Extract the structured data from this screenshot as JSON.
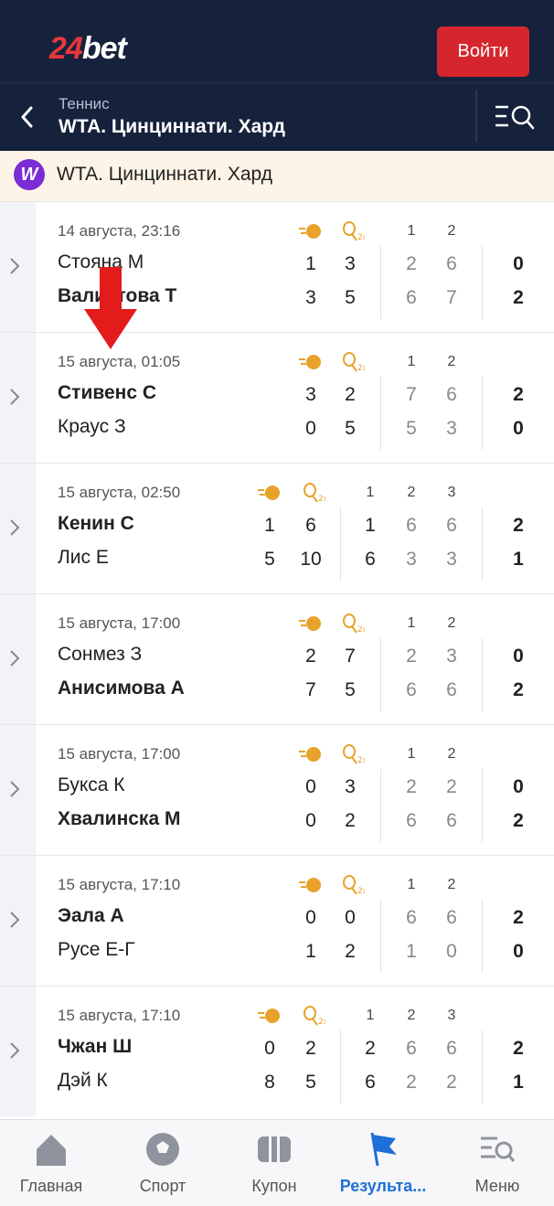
{
  "header": {
    "logo_num": "24",
    "logo_text": "bet",
    "login_label": "Войти"
  },
  "subheader": {
    "sport": "Теннис",
    "title": "WTA. Цинциннати. Хард"
  },
  "league": {
    "logo_letter": "W",
    "name": "WTA. Цинциннати. Хард"
  },
  "matches": [
    {
      "date": "14 августа, 23:16",
      "p1": "Стояна М",
      "p2": "Валиетова Т",
      "sets": [
        "1",
        "2"
      ],
      "p1_games": [
        "1",
        "3"
      ],
      "p2_games": [
        "3",
        "5"
      ],
      "p1_sets": [
        "2",
        "6"
      ],
      "p2_sets": [
        "6",
        "7"
      ],
      "p1_total": "0",
      "p2_total": "2",
      "winner": 2
    },
    {
      "date": "15 августа, 01:05",
      "p1": "Стивенс С",
      "p2": "Краус З",
      "sets": [
        "1",
        "2"
      ],
      "p1_games": [
        "3",
        "2"
      ],
      "p2_games": [
        "0",
        "5"
      ],
      "p1_sets": [
        "7",
        "6"
      ],
      "p2_sets": [
        "5",
        "3"
      ],
      "p1_total": "2",
      "p2_total": "0",
      "winner": 1
    },
    {
      "date": "15 августа, 02:50",
      "p1": "Кенин С",
      "p2": "Лис Е",
      "sets": [
        "1",
        "2",
        "3"
      ],
      "p1_games": [
        "1",
        "6"
      ],
      "p2_games": [
        "5",
        "10"
      ],
      "p1_sets": [
        "1",
        "6",
        "6"
      ],
      "p2_sets": [
        "6",
        "3",
        "3"
      ],
      "p1_total": "2",
      "p2_total": "1",
      "winner": 1
    },
    {
      "date": "15 августа, 17:00",
      "p1": "Сонмез З",
      "p2": "Анисимова А",
      "sets": [
        "1",
        "2"
      ],
      "p1_games": [
        "2",
        "7"
      ],
      "p2_games": [
        "7",
        "5"
      ],
      "p1_sets": [
        "2",
        "3"
      ],
      "p2_sets": [
        "6",
        "6"
      ],
      "p1_total": "0",
      "p2_total": "2",
      "winner": 2
    },
    {
      "date": "15 августа, 17:00",
      "p1": "Букса К",
      "p2": "Хвалинска М",
      "sets": [
        "1",
        "2"
      ],
      "p1_games": [
        "0",
        "3"
      ],
      "p2_games": [
        "0",
        "2"
      ],
      "p1_sets": [
        "2",
        "2"
      ],
      "p2_sets": [
        "6",
        "6"
      ],
      "p1_total": "0",
      "p2_total": "2",
      "winner": 2
    },
    {
      "date": "15 августа, 17:10",
      "p1": "Эала А",
      "p2": "Русе Е-Г",
      "sets": [
        "1",
        "2"
      ],
      "p1_games": [
        "0",
        "0"
      ],
      "p2_games": [
        "1",
        "2"
      ],
      "p1_sets": [
        "6",
        "6"
      ],
      "p2_sets": [
        "1",
        "0"
      ],
      "p1_total": "2",
      "p2_total": "0",
      "winner": 1
    },
    {
      "date": "15 августа, 17:10",
      "p1": "Чжан Ш",
      "p2": "Дэй К",
      "sets": [
        "1",
        "2",
        "3"
      ],
      "p1_games": [
        "0",
        "2"
      ],
      "p2_games": [
        "8",
        "5"
      ],
      "p1_sets": [
        "2",
        "6",
        "6"
      ],
      "p2_sets": [
        "6",
        "2",
        "2"
      ],
      "p1_total": "2",
      "p2_total": "1",
      "winner": 1
    }
  ],
  "tabs": [
    {
      "label": "Главная",
      "icon": "home-icon"
    },
    {
      "label": "Спорт",
      "icon": "ball-icon"
    },
    {
      "label": "Купон",
      "icon": "coupon-icon"
    },
    {
      "label": "Результа...",
      "icon": "flag-icon",
      "active": true
    },
    {
      "label": "Меню",
      "icon": "menu-icon"
    }
  ],
  "colors": {
    "header_bg": "#16223c",
    "brand_red": "#d5262d",
    "active_blue": "#1f6fd8",
    "league_banner_bg": "#fdf3e6"
  }
}
